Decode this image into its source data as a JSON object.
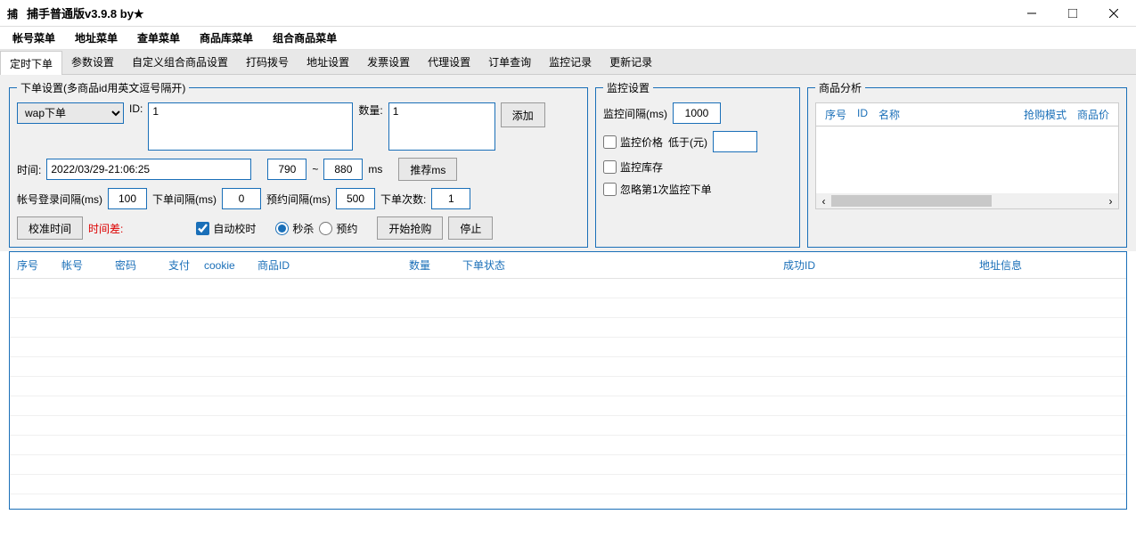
{
  "window": {
    "title": "捕手普通版v3.9.8   by★"
  },
  "menus": [
    "帐号菜单",
    "地址菜单",
    "查单菜单",
    "商品库菜单",
    "组合商品菜单"
  ],
  "tabs": [
    "定时下单",
    "参数设置",
    "自定义组合商品设置",
    "打码拨号",
    "地址设置",
    "发票设置",
    "代理设置",
    "订单查询",
    "监控记录",
    "更新记录"
  ],
  "order": {
    "legend": "下单设置(多商品id用英文逗号隔开)",
    "mode": "wap下单",
    "id_label": "ID:",
    "id_value": "1",
    "qty_label": "数量:",
    "qty_value": "1",
    "add_btn": "添加",
    "time_label": "时间:",
    "time_value": "2022/03/29-21:06:25",
    "ms_from": "790",
    "ms_sep": "~",
    "ms_to": "880",
    "ms_unit": "ms",
    "recommend_btn": "推荐ms",
    "login_interval_label": "帐号登录间隔(ms)",
    "login_interval": "100",
    "order_interval_label": "下单间隔(ms)",
    "order_interval": "0",
    "reserve_interval_label": "预约间隔(ms)",
    "reserve_interval": "500",
    "order_count_label": "下单次数:",
    "order_count": "1",
    "calibrate_btn": "校准时间",
    "time_diff_label": "时间差:",
    "auto_calibrate": "自动校时",
    "radio_seckill": "秒杀",
    "radio_reserve": "预约",
    "start_btn": "开始抢购",
    "stop_btn": "停止"
  },
  "monitor": {
    "legend": "监控设置",
    "interval_label": "监控间隔(ms)",
    "interval": "1000",
    "chk_price": "监控价格",
    "below_label": "低于(元)",
    "below_value": "",
    "chk_stock": "监控库存",
    "chk_ignore_first": "忽略第1次监控下单"
  },
  "analyze": {
    "legend": "商品分析",
    "cols": [
      "序号",
      "ID",
      "名称",
      "抢购模式",
      "商品价"
    ]
  },
  "table": {
    "cols": [
      "序号",
      "帐号",
      "密码",
      "支付",
      "cookie",
      "商品ID",
      "数量",
      "下单状态",
      "成功ID",
      "地址信息"
    ]
  }
}
